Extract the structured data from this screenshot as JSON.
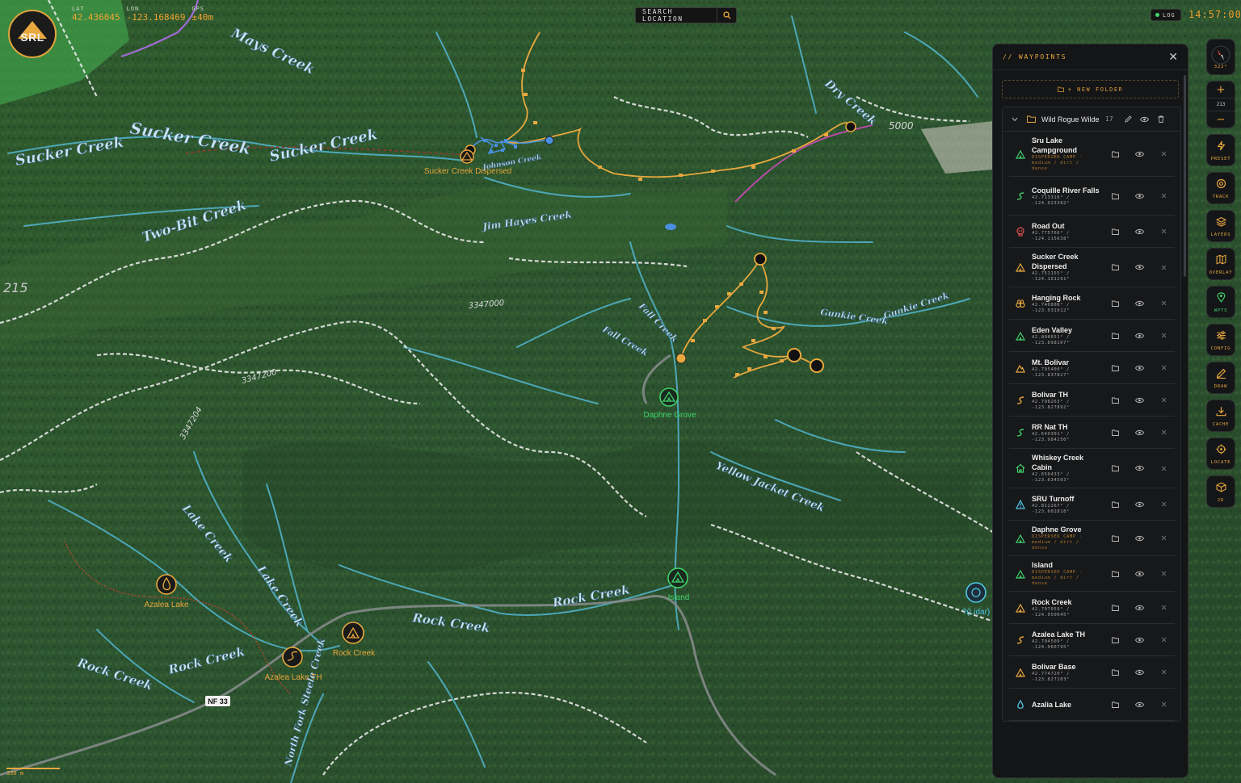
{
  "app": {
    "logo_text": "SRL",
    "coords": {
      "lat_label": "LAT",
      "lat": "42.436045",
      "lon_label": "LON",
      "lon": "-123.168469",
      "gps_label": "GPS",
      "gps": "±40m"
    },
    "search_placeholder": "SEARCH LOCATION",
    "log_label": "LOG",
    "clock": "14:57:00",
    "scale_label": "330 m"
  },
  "map": {
    "creeks": [
      "Sucker Creek",
      "Sucker Creek",
      "Two-Bit Creek",
      "Mays Creek",
      "Sucker Creek",
      "Rock Creek",
      "Rock Creek",
      "Rock Creek",
      "Rock Creek",
      "Lake Creek",
      "Lake Creek",
      "Fall Creek",
      "Fall Creek",
      "Dry Creek",
      "Gunkie Creek",
      "Gunkie Creek",
      "Yellow Jacket Creek",
      "North Fork Steele Creek",
      "Jim Hayes Creek",
      "Johnson Creek"
    ],
    "road_labels": [
      "3347000",
      "3347204",
      "3347200",
      "5000",
      "215"
    ],
    "road_badge": "NF 33",
    "pois": [
      {
        "name": "Sucker Creek Dispersed"
      },
      {
        "name": "Daphne Grove"
      },
      {
        "name": "Island"
      },
      {
        "name": "Azalea Lake"
      },
      {
        "name": "Rock Creek"
      },
      {
        "name": "Azalea Lake TH"
      },
      {
        "name": "?(Lidar)"
      }
    ]
  },
  "panel": {
    "title": "// WAYPOINTS",
    "new_folder": "+ NEW FOLDER",
    "folder_name": "Wild Rogue Wilde",
    "folder_count": "17",
    "waypoints": [
      {
        "name": "Sru Lake Campground",
        "sub": "DISPERSED CAMP · medium / dirt / dense",
        "icon": "tent-icon",
        "color": "#3fd26c",
        "warm": true
      },
      {
        "name": "Coquille River Falls",
        "sub": "42.713316° / -124.023382°",
        "icon": "trail-icon",
        "color": "#3fd26c",
        "warm": false
      },
      {
        "name": "Road Out",
        "sub": "42.775766° / -124.115638°",
        "icon": "skull-icon",
        "color": "#e85050",
        "warm": false
      },
      {
        "name": "Sucker Creek Dispersed",
        "sub": "42.751155° / -124.101291°",
        "icon": "tent-icon",
        "color": "#e8a83e",
        "warm": false
      },
      {
        "name": "Hanging Rock",
        "sub": "42.740808° / -123.931912°",
        "icon": "binoculars-icon",
        "color": "#e8a83e",
        "warm": false
      },
      {
        "name": "Eden Valley",
        "sub": "42.808651° / -123.898107°",
        "icon": "tent-icon",
        "color": "#3fd26c",
        "warm": false
      },
      {
        "name": "Mt. Bolivar",
        "sub": "42.795400° / -123.837827°",
        "icon": "mountain-icon",
        "color": "#e8a83e",
        "warm": false
      },
      {
        "name": "Bolivar TH",
        "sub": "42.798263° / -123.827892°",
        "icon": "trail-icon",
        "color": "#e8a83e",
        "warm": false
      },
      {
        "name": "RR Nat TH",
        "sub": "42.649391° / -123.984250°",
        "icon": "trail-icon",
        "color": "#3fd26c",
        "warm": false
      },
      {
        "name": "Whiskey Creek Cabin",
        "sub": "42.650433° / -123.634503°",
        "icon": "cabin-icon",
        "color": "#3fd26c",
        "warm": false
      },
      {
        "name": "SRU Turnoff",
        "sub": "42.812267° / -123.602818°",
        "icon": "warning-icon",
        "color": "#52c8e6",
        "warm": false
      },
      {
        "name": "Daphne Grove",
        "sub": "DISPERSED CAMP · medium / dirt / dense",
        "icon": "tent-icon",
        "color": "#3fd26c",
        "warm": true
      },
      {
        "name": "Island",
        "sub": "DISPERSED CAMP · medium / dirt / dense",
        "icon": "tent-icon",
        "color": "#3fd26c",
        "warm": true
      },
      {
        "name": "Rock Creek",
        "sub": "42.707059° / -124.050645°",
        "icon": "tent-icon",
        "color": "#e8a83e",
        "warm": false
      },
      {
        "name": "Azalea Lake TH",
        "sub": "42.704509° / -124.060795°",
        "icon": "trail-icon",
        "color": "#e8a83e",
        "warm": false
      },
      {
        "name": "Bolivar Base",
        "sub": "42.774720° / -123.827103°",
        "icon": "tent-icon",
        "color": "#e8a83e",
        "warm": false
      },
      {
        "name": "Azalia Lake",
        "sub": "",
        "icon": "drop-icon",
        "color": "#52c8e6",
        "warm": false
      }
    ]
  },
  "toolbar": {
    "compass_label": "322°",
    "zoom_in": "+",
    "zoom_level": "213",
    "zoom_out": "−",
    "buttons": [
      {
        "label": "PRESET",
        "icon": "bolt-icon"
      },
      {
        "label": "TRACK",
        "icon": "target-icon"
      },
      {
        "label": "LAYERS",
        "icon": "layers-icon"
      },
      {
        "label": "OVERLAY",
        "icon": "map-icon"
      },
      {
        "label": "WPTS",
        "icon": "pin-icon"
      },
      {
        "label": "CONFIG",
        "icon": "sliders-icon"
      },
      {
        "label": "DRAW",
        "icon": "pencil-icon"
      },
      {
        "label": "CACHE",
        "icon": "download-icon"
      },
      {
        "label": "LOCATE",
        "icon": "crosshair-icon"
      },
      {
        "label": "2D",
        "icon": "cube-icon"
      }
    ]
  },
  "colors": {
    "accent": "#e8a83e",
    "green": "#3fd26c",
    "water": "#52c8e6",
    "danger": "#e85050"
  }
}
